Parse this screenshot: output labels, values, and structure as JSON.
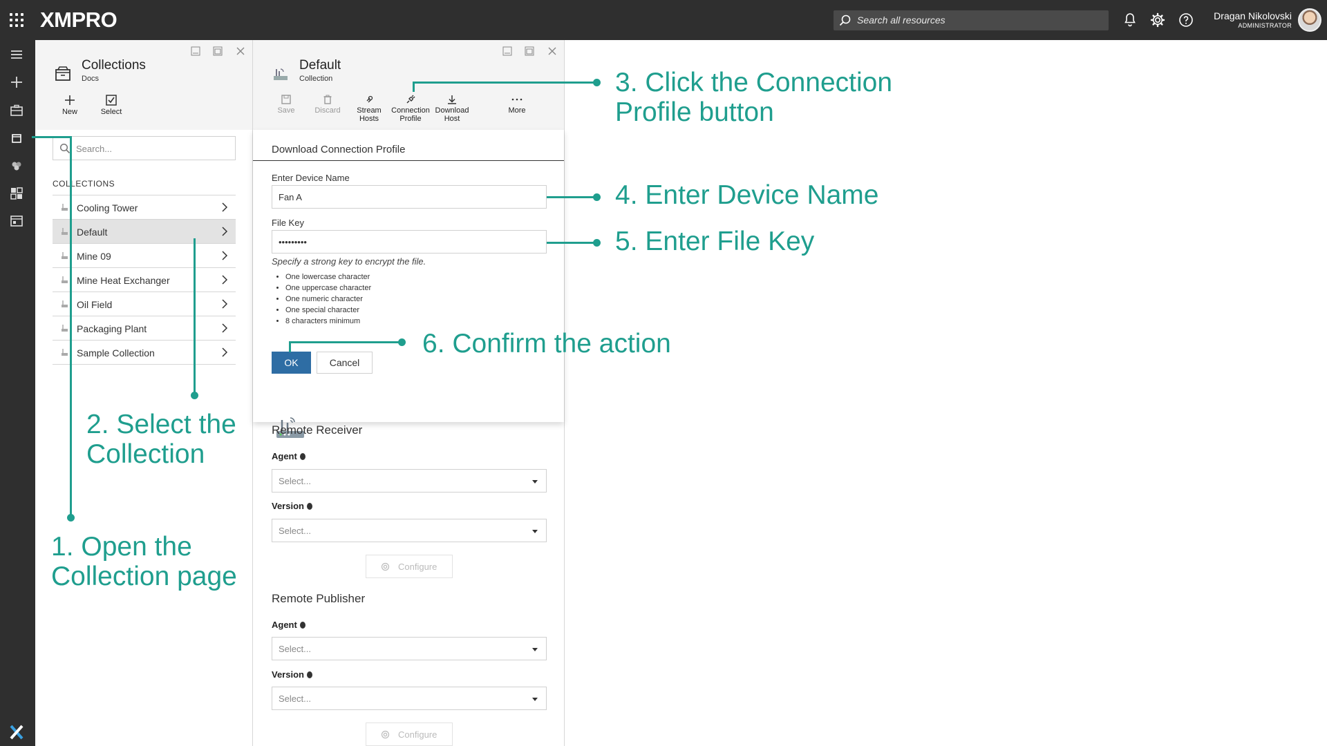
{
  "app": {
    "brand": "XMPRO",
    "search_placeholder": "Search all resources",
    "user_name": "Dragan Nikolovski",
    "user_role": "ADMINISTRATOR"
  },
  "collections_panel": {
    "title": "Collections",
    "subtitle": "Docs",
    "toolbar": {
      "new_label": "New",
      "select_label": "Select"
    },
    "search_placeholder": "Search...",
    "section_label": "COLLECTIONS",
    "items": [
      {
        "label": "Cooling Tower"
      },
      {
        "label": "Default"
      },
      {
        "label": "Mine 09"
      },
      {
        "label": "Mine Heat Exchanger"
      },
      {
        "label": "Oil Field"
      },
      {
        "label": "Packaging Plant"
      },
      {
        "label": "Sample Collection"
      }
    ]
  },
  "default_panel": {
    "title": "Default",
    "subtitle": "Collection",
    "toolbar": {
      "save_label": "Save",
      "discard_label": "Discard",
      "stream_hosts_label_1": "Stream",
      "stream_hosts_label_2": "Hosts",
      "connection_profile_label_1": "Connection",
      "connection_profile_label_2": "Profile",
      "download_host_label_1": "Download",
      "download_host_label_2": "Host",
      "more_label": "More"
    },
    "dialog": {
      "title": "Download Connection Profile",
      "device_name_label": "Enter Device Name",
      "device_name_value": "Fan A",
      "file_key_label": "File Key",
      "file_key_value": "Password1",
      "hint": "Specify a strong key to encrypt the file.",
      "rules": [
        "One lowercase character",
        "One uppercase character",
        "One numeric character",
        "One special character",
        "8 characters minimum"
      ],
      "ok_label": "OK",
      "cancel_label": "Cancel"
    },
    "remote_receiver": {
      "title": "Remote Receiver",
      "agent_label": "Agent",
      "agent_placeholder": "Select...",
      "version_label": "Version",
      "version_placeholder": "Select...",
      "configure_label": "Configure"
    },
    "remote_publisher": {
      "title": "Remote Publisher",
      "agent_label": "Agent",
      "agent_placeholder": "Select...",
      "version_label": "Version",
      "version_placeholder": "Select...",
      "configure_label": "Configure"
    }
  },
  "annotations": {
    "step1_line1": "1. Open the",
    "step1_line2": "Collection page",
    "step2_line1": "2. Select the",
    "step2_line2": "Collection",
    "step3_line1": "3. Click the Connection",
    "step3_line2": "Profile button",
    "step4": "4. Enter Device Name",
    "step5": "5. Enter File Key",
    "step6": "6. Confirm the action",
    "color": "#1f9e8e"
  }
}
